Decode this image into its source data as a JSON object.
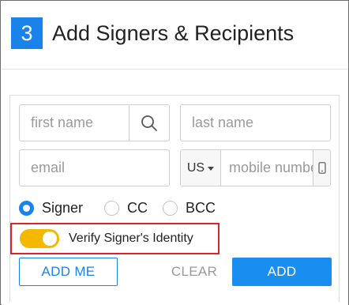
{
  "header": {
    "step_number": "3",
    "title": "Add Signers & Recipients"
  },
  "form": {
    "first_name": {
      "placeholder": "first name",
      "value": ""
    },
    "last_name": {
      "placeholder": "last name",
      "value": ""
    },
    "email": {
      "placeholder": "email",
      "value": ""
    },
    "phone": {
      "country_code": "US",
      "placeholder": "mobile number",
      "value": ""
    },
    "search_icon": "search-icon",
    "phone_icon": "mobile-phone-icon"
  },
  "recipient_type": {
    "selected": "Signer",
    "options": [
      {
        "label": "Signer",
        "checked": true
      },
      {
        "label": "CC",
        "checked": false
      },
      {
        "label": "BCC",
        "checked": false
      }
    ]
  },
  "verify": {
    "label": "Verify Signer's Identity",
    "enabled": true,
    "toggle_color": "#f5b800",
    "highlight_color": "#d9232d"
  },
  "buttons": {
    "add_me": "ADD ME",
    "clear": "CLEAR",
    "add": "ADD"
  },
  "colors": {
    "accent": "#1a83ea",
    "primary_button": "#1a8ef0"
  }
}
